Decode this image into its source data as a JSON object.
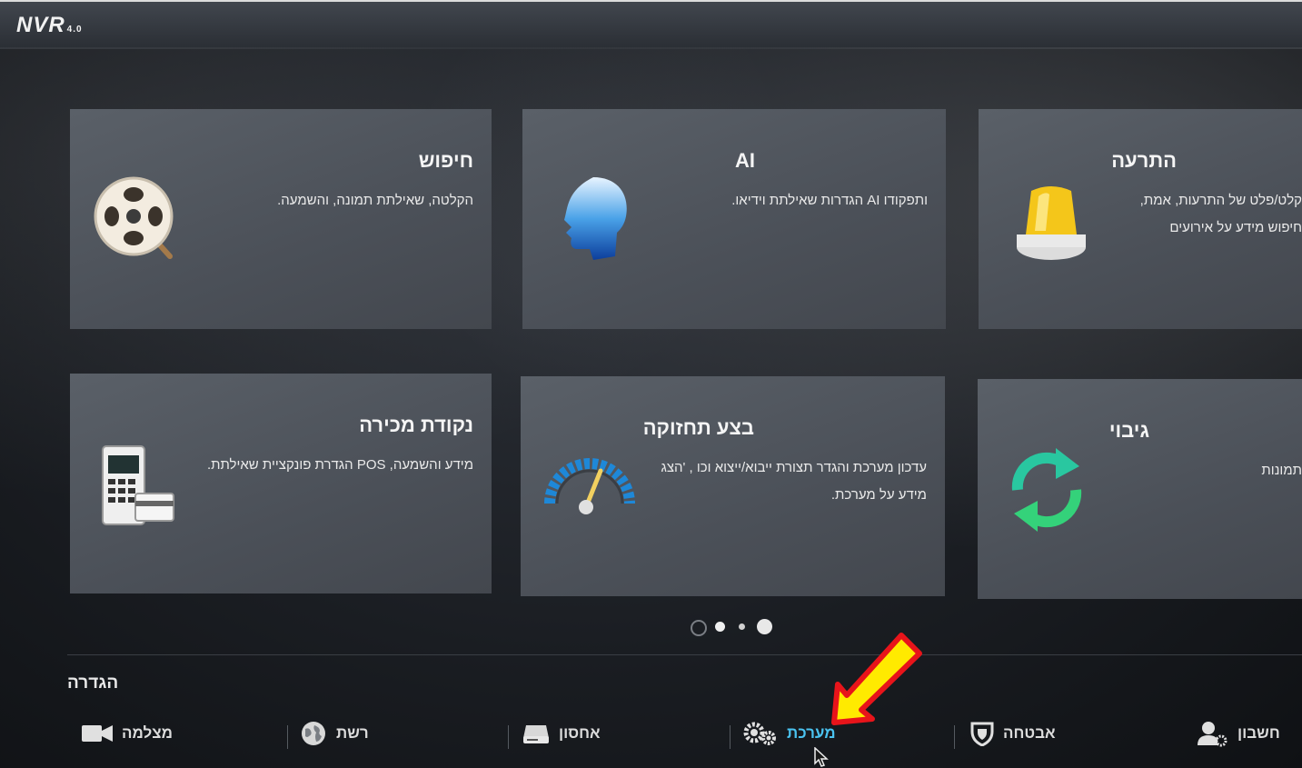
{
  "header": {
    "logo": "NVR",
    "logo_version": "4.0"
  },
  "cards": [
    {
      "title": "חיפוש",
      "desc": "הקלטה, שאילתת תמונה, והשמעה.",
      "icon": "film-reel-search-icon"
    },
    {
      "title": "AI",
      "desc": "ותפקודו AI הגדרות שאילתת וידיאו.",
      "icon": "ai-head-icon"
    },
    {
      "title": "התרעה",
      "desc": "קלט/פלט של התרעות, אמת, חיפוש מידע על אירועים",
      "icon": "alarm-beacon-icon"
    },
    {
      "title": "נקודת מכירה",
      "desc": "מידע והשמעה, POS הגדרת פונקציית שאילתת.",
      "icon": "pos-terminal-icon"
    },
    {
      "title": "בצע תחזוקה",
      "desc": "עדכון מערכת והגדר תצורת ייבוא/ייצוא וכו , 'הצג מידע על מערכת.",
      "icon": "gauge-icon"
    },
    {
      "title": "גיבוי",
      "desc": "תמונות",
      "icon": "sync-arrows-icon"
    }
  ],
  "settings": {
    "label": "הגדרה",
    "items": [
      {
        "label": "מצלמה",
        "icon": "camera-icon"
      },
      {
        "label": "רשת",
        "icon": "network-globe-icon"
      },
      {
        "label": "אחסון",
        "icon": "hard-drive-icon"
      },
      {
        "label": "מערכת",
        "icon": "gears-icon",
        "active": true
      },
      {
        "label": "אבטחה",
        "icon": "shield-icon"
      },
      {
        "label": "חשבון",
        "icon": "user-settings-icon"
      }
    ]
  },
  "colors": {
    "active": "#4ac3f0",
    "card": "#50555d",
    "arrow_fill": "#ffea00",
    "arrow_stroke": "#e8141a"
  }
}
